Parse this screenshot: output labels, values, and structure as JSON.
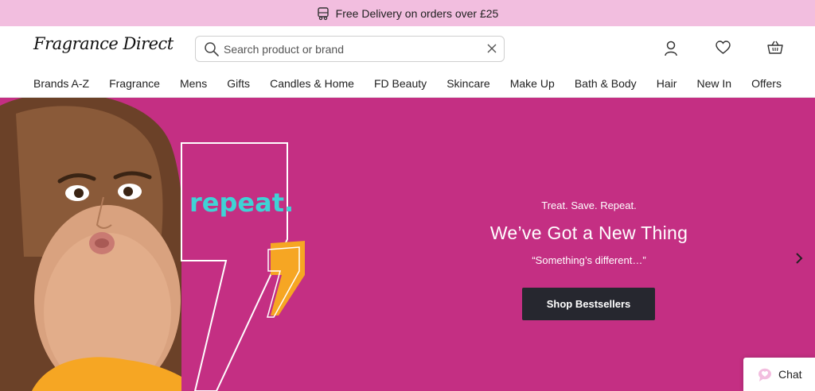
{
  "promo": {
    "icon": "delivery-van-icon",
    "text": "Free Delivery on orders over £25"
  },
  "header": {
    "logo_text": "Fragrance Direct",
    "search": {
      "placeholder": "Search product or brand",
      "value": ""
    },
    "icons": [
      "account-icon",
      "wishlist-heart-icon",
      "basket-icon"
    ]
  },
  "nav": {
    "items": [
      "Brands A-Z",
      "Fragrance",
      "Mens",
      "Gifts",
      "Candles & Home",
      "FD Beauty",
      "Skincare",
      "Make Up",
      "Bath & Body",
      "Hair",
      "New In",
      "Offers"
    ]
  },
  "hero": {
    "art_text": "repeat.",
    "eyebrow": "Treat. Save. Repeat.",
    "headline": "We’ve Got a New Thing",
    "sub": "“Something’s different…”",
    "cta": "Shop Bestsellers",
    "background": "#c42f83",
    "accent_orange": "#f6a623",
    "accent_teal": "#3fd3d5"
  },
  "chat": {
    "label": "Chat"
  }
}
